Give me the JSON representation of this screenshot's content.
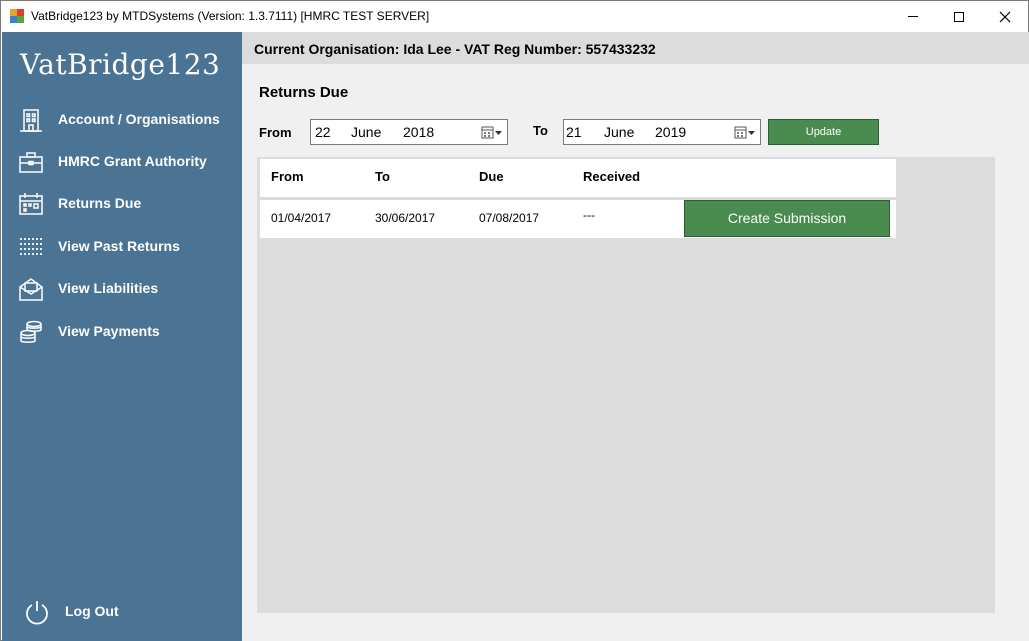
{
  "window": {
    "title": "VatBridge123 by MTDSystems (Version: 1.3.7111) [HMRC TEST SERVER]"
  },
  "sidebar": {
    "logo": "VatBridge123",
    "items": [
      {
        "label": "Account / Organisations",
        "icon": "building-icon"
      },
      {
        "label": "HMRC Grant Authority",
        "icon": "briefcase-icon"
      },
      {
        "label": "Returns Due",
        "icon": "calendar-icon"
      },
      {
        "label": "View Past Returns",
        "icon": "list-icon"
      },
      {
        "label": "View Liabilities",
        "icon": "envelope-icon"
      },
      {
        "label": "View Payments",
        "icon": "coins-icon"
      }
    ],
    "logout_label": "Log Out"
  },
  "header": {
    "organisation": "Current Organisation: Ida Lee - VAT Reg Number: 557433232"
  },
  "main": {
    "title": "Returns Due",
    "from_label": "From",
    "to_label": "To",
    "from_date": {
      "day": "22",
      "month": "June",
      "year": "2018"
    },
    "to_date": {
      "day": "21",
      "month": "June",
      "year": "2019"
    },
    "update_label": "Update",
    "table": {
      "columns": [
        "From",
        "To",
        "Due",
        "Received"
      ],
      "rows": [
        {
          "from": "01/04/2017",
          "to": "30/06/2017",
          "due": "07/08/2017",
          "received": "---",
          "action": "Create Submission"
        }
      ]
    }
  },
  "colors": {
    "sidebar": "#4a7394",
    "header_bar": "#dcdcdc",
    "button_green": "#4a8c50"
  }
}
